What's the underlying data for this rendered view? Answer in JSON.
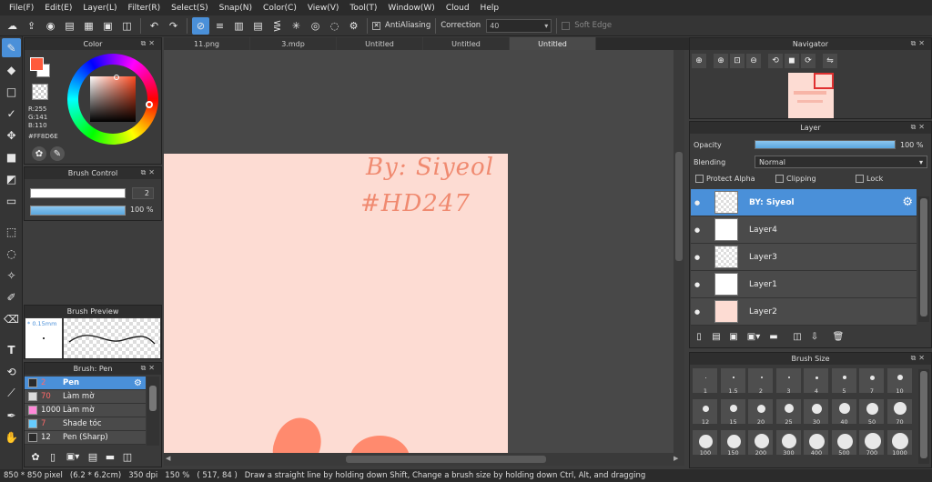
{
  "menu": [
    "File(F)",
    "Edit(E)",
    "Layer(L)",
    "Filter(R)",
    "Select(S)",
    "Snap(N)",
    "Color(C)",
    "View(V)",
    "Tool(T)",
    "Window(W)",
    "Cloud",
    "Help"
  ],
  "toolbar": {
    "antialiasing_label": "AntiAliasing",
    "correction_label": "Correction",
    "correction_value": "40",
    "soft_edge_label": "Soft Edge"
  },
  "tabs": [
    "11.png",
    "3.mdp",
    "Untitled",
    "Untitled",
    "Untitled"
  ],
  "color_panel": {
    "title": "Color",
    "r": "R:255",
    "g": "G:141",
    "b": "B:110",
    "hex": "#FF8D6E",
    "fg_color": "#ff5a3c"
  },
  "brush_control": {
    "title": "Brush Control",
    "size_value": "2",
    "opacity_value": "100 %"
  },
  "brush_preview": {
    "title": "Brush Preview",
    "size_label": "* 0.15mm"
  },
  "brush_list": {
    "title": "Brush: Pen",
    "items": [
      {
        "num": "2",
        "name": "Pen",
        "swatch": "#2a2a2a",
        "selected": true
      },
      {
        "num": "70",
        "name": "Làm mờ",
        "swatch": "#dddddd",
        "selected": false
      },
      {
        "num": "1000",
        "name": "Làm mờ",
        "swatch": "#ff88d8",
        "selected": false
      },
      {
        "num": "7",
        "name": "Shade tóc",
        "swatch": "#66ccff",
        "selected": false
      },
      {
        "num": "12",
        "name": "Pen (Sharp)",
        "swatch": "#2a2a2a",
        "selected": false
      }
    ]
  },
  "canvas": {
    "text_line1": "By: Siyeol",
    "text_line2": "#HD247"
  },
  "navigator": {
    "title": "Navigator"
  },
  "layer_panel": {
    "title": "Layer",
    "opacity_label": "Opacity",
    "opacity_value": "100 %",
    "opacity_fraction": 1.0,
    "blending_label": "Blending",
    "blending_value": "Normal",
    "protect_alpha": "Protect Alpha",
    "clipping": "Clipping",
    "lock": "Lock",
    "layers": [
      {
        "name": "BY: Siyeol",
        "selected": true
      },
      {
        "name": "Layer4",
        "selected": false
      },
      {
        "name": "Layer3",
        "selected": false
      },
      {
        "name": "Layer1",
        "selected": false
      },
      {
        "name": "Layer2",
        "selected": false
      }
    ]
  },
  "brush_size": {
    "title": "Brush Size",
    "sizes": [
      "1",
      "1.5",
      "2",
      "3",
      "4",
      "5",
      "7",
      "10",
      "12",
      "15",
      "20",
      "25",
      "30",
      "40",
      "50",
      "70",
      "100",
      "150",
      "200",
      "300",
      "400",
      "500",
      "700",
      "1000"
    ]
  },
  "status": {
    "size": "850 * 850 pixel",
    "cm": "(6.2 * 6.2cm)",
    "dpi": "350 dpi",
    "zoom": "150 %",
    "coords": "( 517, 84 )",
    "hint": "Draw a straight line by holding down Shift, Change a brush size by holding down Ctrl, Alt, and dragging"
  },
  "colors": {
    "accent": "#4a90d9",
    "paper": "#fddcd3",
    "ink": "#f08a70"
  }
}
